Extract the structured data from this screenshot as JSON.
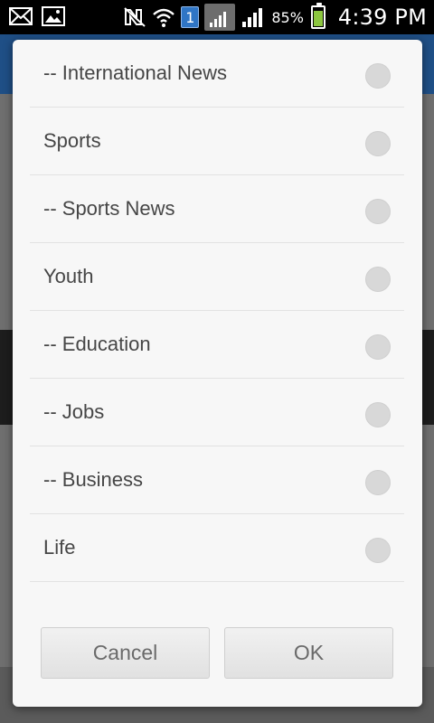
{
  "status_bar": {
    "notification_icons": [
      "mail-icon",
      "image-icon"
    ],
    "sim_number": "1",
    "battery_percent": "85%",
    "battery_level": 0.85,
    "time": "4:39 PM",
    "colors": {
      "battery_fill": "#8cc63f",
      "sim_badge": "#2f75c5"
    }
  },
  "dialog": {
    "items": [
      {
        "label": "-- International News",
        "selected": false
      },
      {
        "label": "Sports",
        "selected": false
      },
      {
        "label": "-- Sports News",
        "selected": false
      },
      {
        "label": "Youth",
        "selected": false
      },
      {
        "label": "-- Education",
        "selected": false
      },
      {
        "label": "-- Jobs",
        "selected": false
      },
      {
        "label": "-- Business",
        "selected": false
      },
      {
        "label": "Life",
        "selected": false
      }
    ],
    "cancel_label": "Cancel",
    "ok_label": "OK"
  }
}
